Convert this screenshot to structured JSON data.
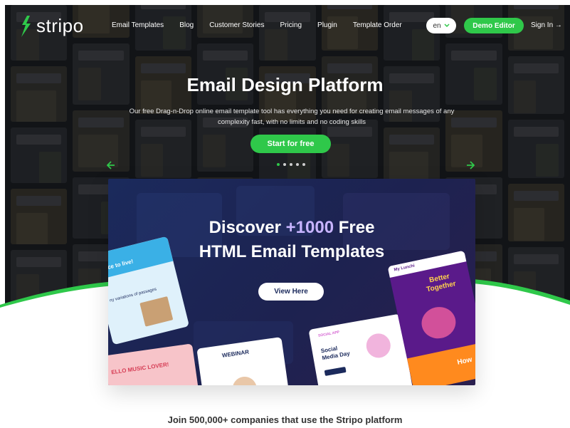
{
  "header": {
    "logo_text": "stripo",
    "nav": [
      "Email Templates",
      "Blog",
      "Customer Stories",
      "Pricing",
      "Plugin",
      "Template Order"
    ],
    "language": "en",
    "demo_button": "Demo Editor",
    "signin": "Sign In →"
  },
  "hero": {
    "title": "Email Design Platform",
    "subtitle": "Our free Drag-n-Drop online email template tool has everything you need for creating email messages of any complexity fast, with no limits and no coding skills",
    "cta": "Start for free",
    "slide_count": 5,
    "active_slide": 1
  },
  "banner": {
    "title_part1": "Discover ",
    "title_accent": "+1000",
    "title_part2": " Free",
    "title_line2": "HTML Email Templates",
    "button": "View Here",
    "card_texts": {
      "card1_heading": "ace to live!",
      "card1_sub": "ny variations of passages",
      "card2_heading": "ELLO MUSIC LOVER!",
      "card3_heading": "WEBINAR",
      "card4_heading": "Social Media Day",
      "card4_tag": "SOCIAL APP",
      "card5_heading": "Better Together",
      "card5_tag": "My Lunchi",
      "card5_footer": "How"
    }
  },
  "footer_text": "Join 500,000+ companies that use the Stripo platform",
  "colors": {
    "brand_green": "#2fc84a",
    "banner_navy": "#1b2a5c",
    "accent_lavender": "#c8b4ff"
  }
}
